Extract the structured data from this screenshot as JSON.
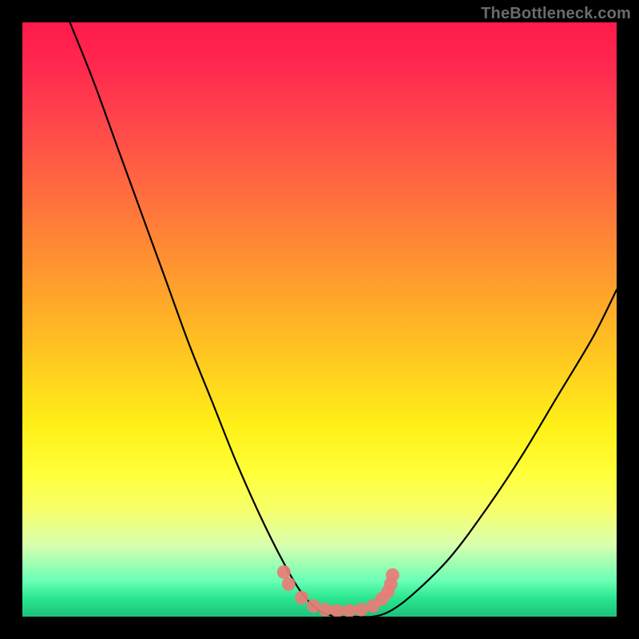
{
  "watermark": {
    "text": "TheBottleneck.com"
  },
  "chart_data": {
    "type": "line",
    "title": "",
    "xlabel": "",
    "ylabel": "",
    "xlim": [
      0,
      100
    ],
    "ylim": [
      0,
      100
    ],
    "grid": false,
    "legend": false,
    "series": [
      {
        "name": "bottleneck-curve",
        "x": [
          8,
          12,
          16,
          20,
          24,
          28,
          32,
          36,
          40,
          44,
          47,
          50,
          53,
          56,
          59,
          62,
          66,
          72,
          78,
          84,
          90,
          96,
          100
        ],
        "values": [
          100,
          90,
          79,
          68,
          57,
          46,
          36,
          26,
          17,
          9,
          4,
          1,
          0,
          0,
          0,
          1,
          4,
          10,
          18,
          27,
          37,
          47,
          55
        ]
      }
    ],
    "markers": {
      "name": "highlight-dots",
      "x": [
        44,
        44.8,
        47,
        49,
        51,
        53,
        55,
        57,
        59,
        60.5,
        61.5,
        62,
        62.3
      ],
      "values": [
        7.5,
        5.5,
        3.2,
        1.8,
        1.2,
        1.0,
        1.0,
        1.2,
        1.8,
        3.0,
        4.2,
        5.5,
        7.0
      ]
    },
    "gradient_stops": [
      {
        "pct": 0,
        "color": "#ff1a4b"
      },
      {
        "pct": 18,
        "color": "#ff4a4a"
      },
      {
        "pct": 38,
        "color": "#ff8b34"
      },
      {
        "pct": 58,
        "color": "#ffce1f"
      },
      {
        "pct": 76,
        "color": "#ffff3a"
      },
      {
        "pct": 94,
        "color": "#68ffb5"
      },
      {
        "pct": 100,
        "color": "#1ec17a"
      }
    ]
  }
}
